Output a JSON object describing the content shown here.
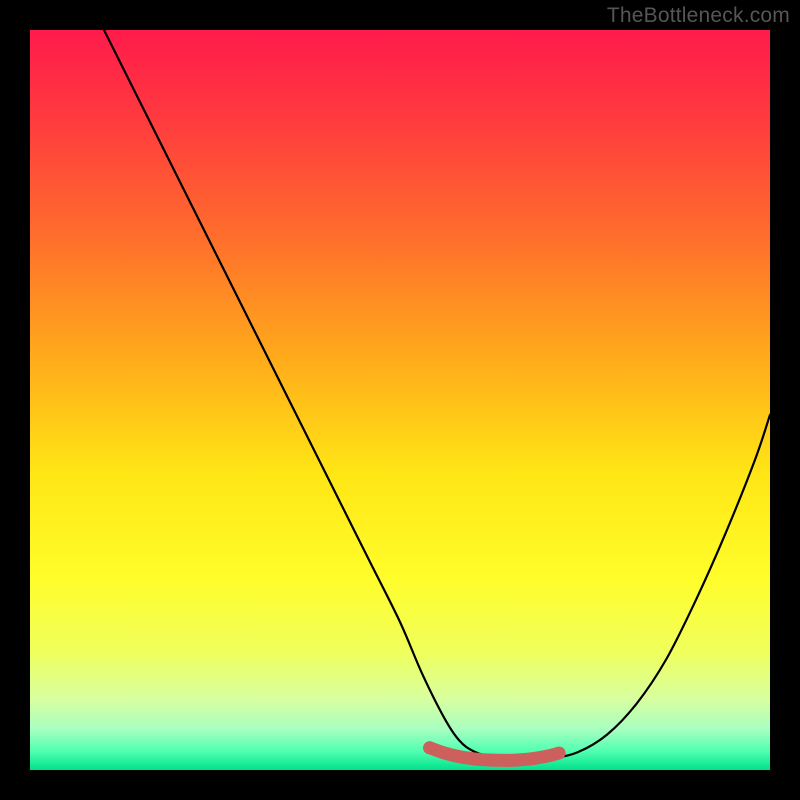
{
  "watermark": "TheBottleneck.com",
  "colors": {
    "bg_black": "#000000",
    "curve": "#000000",
    "annotation": "#cd5f5c",
    "gradient_stops": [
      {
        "offset": 0.0,
        "color": "#ff1b4b"
      },
      {
        "offset": 0.12,
        "color": "#ff3a3f"
      },
      {
        "offset": 0.28,
        "color": "#ff6e2c"
      },
      {
        "offset": 0.45,
        "color": "#ffad1a"
      },
      {
        "offset": 0.6,
        "color": "#ffe615"
      },
      {
        "offset": 0.74,
        "color": "#fffd2a"
      },
      {
        "offset": 0.84,
        "color": "#f0ff5c"
      },
      {
        "offset": 0.905,
        "color": "#d7ffa0"
      },
      {
        "offset": 0.945,
        "color": "#a7ffc1"
      },
      {
        "offset": 0.975,
        "color": "#4fffb0"
      },
      {
        "offset": 1.0,
        "color": "#00e28c"
      }
    ]
  },
  "chart_data": {
    "type": "line",
    "title": "",
    "xlabel": "",
    "ylabel": "",
    "xlim": [
      0,
      100
    ],
    "ylim": [
      0,
      100
    ],
    "grid": false,
    "series": [
      {
        "name": "bottleneck-curve",
        "x": [
          10,
          14,
          18,
          22,
          26,
          30,
          34,
          38,
          42,
          46,
          50,
          53,
          56,
          58,
          60,
          63,
          66,
          70,
          74,
          78,
          82,
          86,
          90,
          94,
          98,
          100
        ],
        "y": [
          100,
          92,
          84,
          76,
          68,
          60,
          52,
          44,
          36,
          28,
          20,
          13,
          7,
          4,
          2.5,
          1.6,
          1.3,
          1.5,
          2.4,
          4.8,
          9,
          15,
          23,
          32,
          42,
          48
        ]
      }
    ],
    "annotations": [
      {
        "name": "optimal-range-marker",
        "type": "curve-overlay",
        "x": [
          54,
          56,
          58,
          60,
          62,
          64,
          66,
          68,
          70,
          71.5
        ],
        "y": [
          3.0,
          2.3,
          1.8,
          1.5,
          1.35,
          1.3,
          1.35,
          1.55,
          1.9,
          2.3
        ],
        "end_dot": {
          "x": 54,
          "y": 3.0
        }
      }
    ]
  }
}
